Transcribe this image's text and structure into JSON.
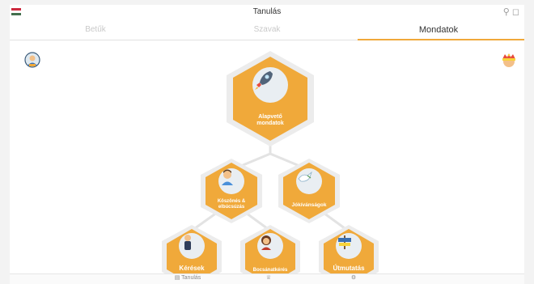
{
  "header": {
    "title": "Tanulás",
    "flag_colors": [
      "#cd2a3e",
      "#ffffff",
      "#436f4d"
    ],
    "icons": [
      "search-icon",
      "bell-icon"
    ]
  },
  "tabs": [
    {
      "label": "Betűk",
      "active": false
    },
    {
      "label": "Szavak",
      "active": false
    },
    {
      "label": "Mondatok",
      "active": true
    }
  ],
  "corner_icons": {
    "left": "profile-icon",
    "right": "crown-icon"
  },
  "accent_color": "#f0a93a",
  "lessons": [
    {
      "label_lines": [
        "Alapvető",
        "mondatok"
      ],
      "icon": "rocket-icon"
    },
    {
      "label_lines": [
        "Köszönés &",
        "elbúcsúzás"
      ],
      "icon": "boy-icon"
    },
    {
      "label_lines": [
        "Jókívánságok"
      ],
      "icon": "dove-icon"
    },
    {
      "label_lines": [
        "Kérések"
      ],
      "icon": "man-icon"
    },
    {
      "label_lines": [
        "Bocsánatkérés"
      ],
      "icon": "girl-icon"
    },
    {
      "label_lines": [
        "Útmutatás"
      ],
      "icon": "sign-icon"
    }
  ],
  "bottom_nav": [
    {
      "label": "Tanulás",
      "icon": "book-icon"
    },
    {
      "label": "",
      "icon": "trophy-icon"
    },
    {
      "label": "",
      "icon": "settings-icon"
    }
  ]
}
